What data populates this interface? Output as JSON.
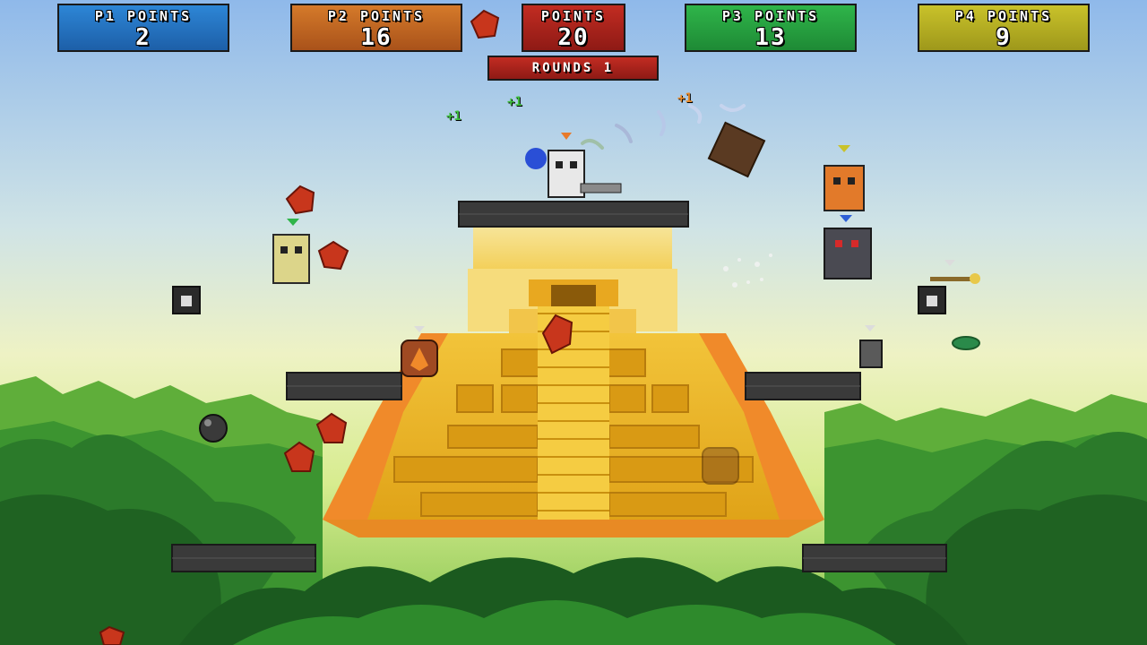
{
  "hud": {
    "p1": {
      "label": "P1 POINTS",
      "value": "2"
    },
    "p2": {
      "label": "P2 POINTS",
      "value": "16"
    },
    "total": {
      "label": "POINTS",
      "value": "20"
    },
    "p3": {
      "label": "P3 POINTS",
      "value": "13"
    },
    "p4": {
      "label": "P4 POINTS",
      "value": "9"
    },
    "rounds": "ROUNDS 1"
  },
  "popups": {
    "a": "+1",
    "b": "+1",
    "c": "+1"
  },
  "colors": {
    "p1": "#2d86d6",
    "p2": "#d57a2a",
    "p3": "#2fb54a",
    "p4": "#c9c22a",
    "pot": "#c22c22"
  }
}
